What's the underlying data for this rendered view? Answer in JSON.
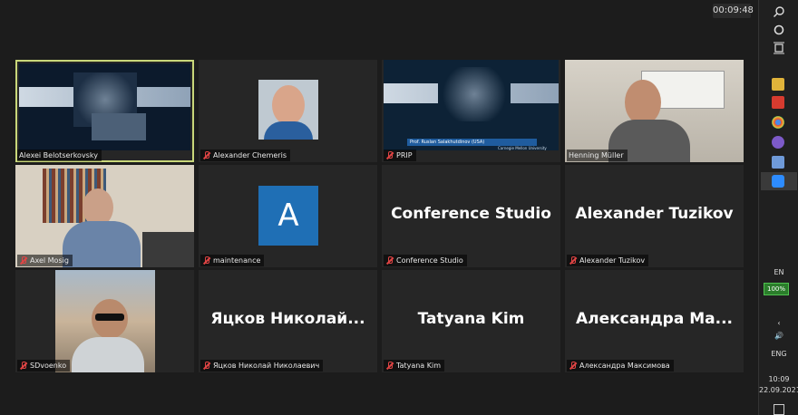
{
  "meeting": {
    "timer": "00:09:48",
    "tiles": [
      {
        "name": "Alexei Belotserkovsky",
        "type": "share",
        "active": true
      },
      {
        "name": "Alexander Chemeris",
        "type": "video"
      },
      {
        "name": "PRIP",
        "type": "share",
        "share_subtitle": "Prof. Ruslan Salakhutdinov (USA)",
        "share_org": "Carnegie Mellon University"
      },
      {
        "name": "Henning Müller",
        "type": "video"
      },
      {
        "name": "Axel Mosig",
        "type": "video"
      },
      {
        "name": "maintenance",
        "type": "avatar",
        "avatar_letter": "A"
      },
      {
        "name": "Conference Studio",
        "type": "text",
        "display": "Conference Studio"
      },
      {
        "name": "Alexander Tuzikov",
        "type": "text",
        "display": "Alexander Tuzikov"
      },
      {
        "name": "SDvoenko",
        "type": "video"
      },
      {
        "name": "Яцков Николай Николаевич",
        "type": "text",
        "display": "Яцков  Николай..."
      },
      {
        "name": "Tatyana Kim",
        "type": "text",
        "display": "Tatyana Kim"
      },
      {
        "name": "Александра Максимова",
        "type": "text",
        "display": "Александра  Ма..."
      }
    ]
  },
  "taskbar": {
    "lang_top": "EN",
    "battery": "100%",
    "lang_bottom": "ENG",
    "time": "10:09",
    "date": "22.09.2021"
  },
  "colors": {
    "active_outline": "#c9d77a",
    "avatar_bg": "#1f6fb5",
    "muted_mic": "#e04444"
  }
}
